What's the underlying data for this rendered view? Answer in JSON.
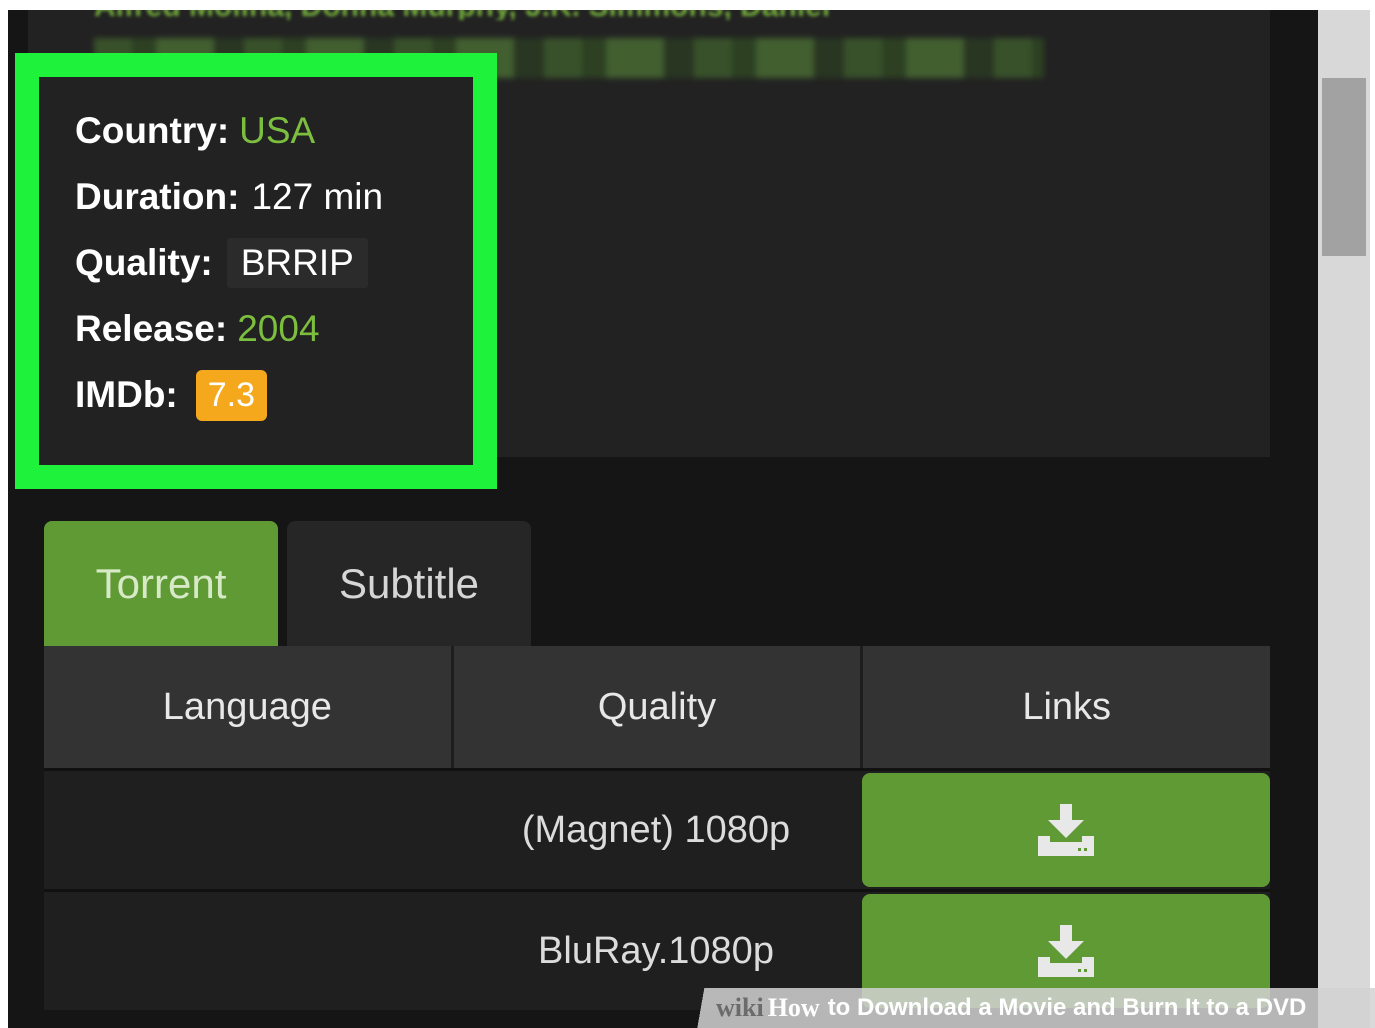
{
  "movie_details": {
    "cast_line": "Alfred Molina, Donna Murphy, J.K. Simmons, Daniel",
    "country_label": "Country:",
    "country_value": "USA",
    "duration_label": "Duration:",
    "duration_value": "127 min",
    "quality_label": "Quality:",
    "quality_value": "BRRIP",
    "release_label": "Release:",
    "release_value": "2004",
    "imdb_label": "IMDb:",
    "imdb_value": "7.3"
  },
  "tabs": [
    {
      "label": "Torrent",
      "active": true
    },
    {
      "label": "Subtitle",
      "active": false
    }
  ],
  "links_table": {
    "headers": [
      "Language",
      "Quality",
      "Links"
    ],
    "rows": [
      {
        "language": "",
        "quality": "(Magnet) 1080p",
        "link_icon": "download-icon"
      },
      {
        "language": "",
        "quality": "BluRay.1080p",
        "link_icon": "download-icon"
      }
    ]
  },
  "watermark": {
    "wiki": "wiki",
    "how": "How",
    "rest": "to Download a Movie and Burn It to a DVD"
  },
  "colors": {
    "highlight": "#1ef23a",
    "accent_green": "#5f9a35",
    "text_green": "#7cbf3f",
    "imdb_badge": "#f5a81b",
    "background": "#151515"
  }
}
